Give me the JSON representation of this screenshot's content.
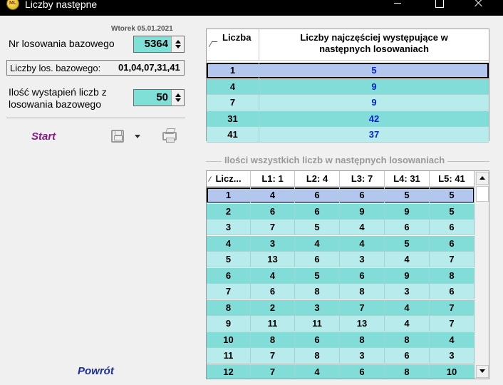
{
  "window": {
    "title": "Liczby następne",
    "icon": "lotto-app-icon",
    "icon_text": "ML"
  },
  "left": {
    "date": "Wtorek 05.01.2021",
    "draw_label": "Nr losowania bazowego",
    "draw_value": "5364",
    "base_numbers_label": "Liczby los. bazowego:",
    "base_numbers_value": "01,04,07,31,41",
    "occurrences_label_line1": "Ilość wystapień liczb z",
    "occurrences_label_line2": "losowania bazowego",
    "occurrences_value": "50",
    "start_label": "Start",
    "back_label": "Powrót"
  },
  "top_grid": {
    "col1_header": "Liczba",
    "col2_header_line1": "Liczby najczęściej występujące w",
    "col2_header_line2": "następnych losowaniach",
    "rows": [
      {
        "number": "1",
        "value": "5"
      },
      {
        "number": "4",
        "value": "9"
      },
      {
        "number": "7",
        "value": "9"
      },
      {
        "number": "31",
        "value": "42"
      },
      {
        "number": "41",
        "value": "37"
      }
    ],
    "selected_row": 0
  },
  "bottom_grid": {
    "group_title": "Ilości wszystkich liczb w następnych losowaniach",
    "headers": [
      "Licz...",
      "L1: 1",
      "L2: 4",
      "L3: 7",
      "L4: 31",
      "L5: 41"
    ],
    "rows": [
      [
        "1",
        "4",
        "6",
        "6",
        "5",
        "5"
      ],
      [
        "2",
        "6",
        "6",
        "9",
        "9",
        "5"
      ],
      [
        "3",
        "7",
        "5",
        "4",
        "6",
        "6"
      ],
      [
        "4",
        "3",
        "4",
        "4",
        "5",
        "6"
      ],
      [
        "5",
        "13",
        "6",
        "3",
        "4",
        "7"
      ],
      [
        "6",
        "4",
        "5",
        "6",
        "9",
        "8"
      ],
      [
        "7",
        "6",
        "8",
        "8",
        "3",
        "6"
      ],
      [
        "8",
        "2",
        "3",
        "7",
        "4",
        "7"
      ],
      [
        "9",
        "11",
        "11",
        "13",
        "4",
        "7"
      ],
      [
        "10",
        "8",
        "6",
        "8",
        "8",
        "4"
      ],
      [
        "11",
        "7",
        "8",
        "3",
        "6",
        "3"
      ],
      [
        "12",
        "7",
        "4",
        "6",
        "8",
        "10"
      ]
    ],
    "selected_row": 0
  },
  "colors": {
    "row_light": "#b8ecec",
    "row_dark": "#82dcd8",
    "selected": "#b3c6ee",
    "value_blue": "#0a24c8",
    "start_purple": "#8b1a8b",
    "back_blue": "#1a2e9e"
  }
}
